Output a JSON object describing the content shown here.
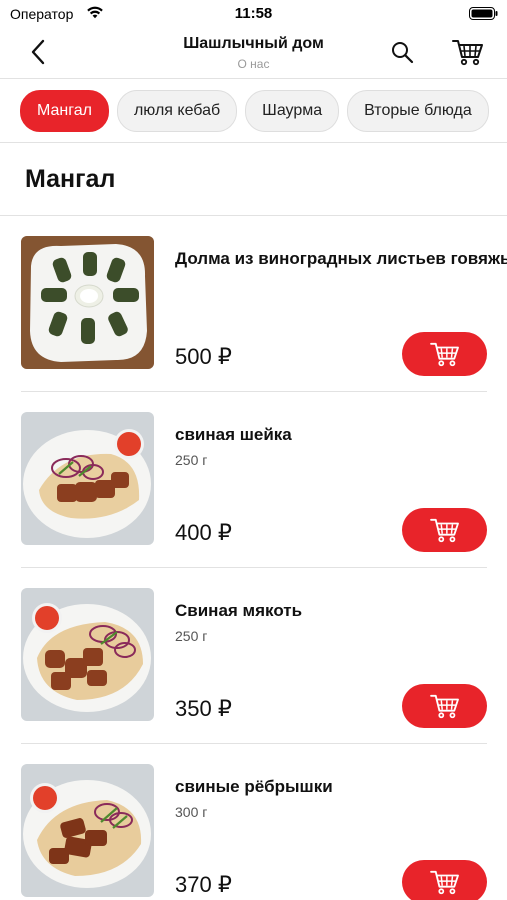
{
  "status_bar": {
    "carrier": "Оператор",
    "time": "11:58"
  },
  "nav": {
    "title": "Шашлычный дом",
    "subtitle": "О нас",
    "icons": {
      "back": "chevron-left-icon",
      "search": "search-icon",
      "cart": "cart-icon"
    }
  },
  "categories": [
    {
      "label": "Мангал",
      "active": true
    },
    {
      "label": "люля кебаб",
      "active": false
    },
    {
      "label": "Шаурма",
      "active": false
    },
    {
      "label": "Вторые блюда",
      "active": false
    }
  ],
  "section": {
    "title": "Мангал"
  },
  "products": [
    {
      "name": "Долма из виноградных листьев говяжья",
      "weight": "",
      "price": "500 ₽"
    },
    {
      "name": "свиная  шейка",
      "weight": "250 г",
      "price": "400 ₽"
    },
    {
      "name": "Свиная мякоть",
      "weight": "250 г",
      "price": "350 ₽"
    },
    {
      "name": "свиные рёбрышки",
      "weight": "300 г",
      "price": "370 ₽"
    }
  ],
  "colors": {
    "accent": "#e8242a",
    "text": "#111111",
    "muted": "#9a9a9a",
    "divider": "#e2e2e2"
  }
}
